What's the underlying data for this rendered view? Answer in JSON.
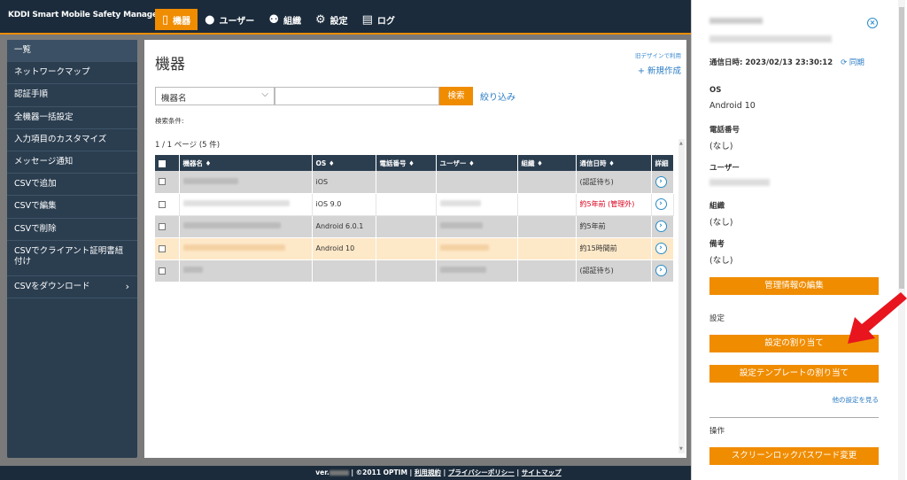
{
  "app": {
    "title": "KDDI Smart Mobile Safety Manager"
  },
  "nav": [
    {
      "label": "機器",
      "icon": "phone-icon",
      "active": true
    },
    {
      "label": "ユーザー",
      "icon": "user-icon",
      "active": false
    },
    {
      "label": "組織",
      "icon": "group-icon",
      "active": false
    },
    {
      "label": "設定",
      "icon": "gear-icon",
      "active": false
    },
    {
      "label": "ログ",
      "icon": "document-icon",
      "active": false
    }
  ],
  "sidebar": {
    "items": [
      {
        "label": "一覧"
      },
      {
        "label": "ネットワークマップ"
      },
      {
        "label": "認証手順"
      },
      {
        "label": "全機器一括設定"
      },
      {
        "label": "入力項目のカスタマイズ"
      },
      {
        "label": "メッセージ通知"
      },
      {
        "label": "CSVで追加"
      },
      {
        "label": "CSVで編集"
      },
      {
        "label": "CSVで削除"
      },
      {
        "label": "CSVでクライアント証明書紐付け"
      },
      {
        "label": "CSVをダウンロード",
        "arrow": "›"
      }
    ]
  },
  "main": {
    "title": "機器",
    "old_design_link": "旧デザインで利用",
    "new_button": "+ 新規作成",
    "search": {
      "select_value": "機器名",
      "chevron": "⌵",
      "button": "検索",
      "filter_link": "絞り込み"
    },
    "conditions_label": "検索条件:",
    "paging": "1 / 1 ページ (5 件)",
    "table": {
      "headers": [
        "機器名 ♦",
        "OS ♦",
        "電話番号 ♦",
        "ユーザー ♦",
        "組織 ♦",
        "通信日時 ♦",
        "詳細"
      ],
      "rows": [
        {
          "os": "iOS",
          "comm": "(認証待ち)",
          "comm_red": false,
          "style": "g"
        },
        {
          "os": "iOS 9.0",
          "comm": "約5年前 (管理外)",
          "comm_red": true,
          "style": "w"
        },
        {
          "os": "Android 6.0.1",
          "comm": "約5年前",
          "comm_red": false,
          "style": "g"
        },
        {
          "os": "Android 10",
          "comm": "約15時間前",
          "comm_red": false,
          "style": "hl"
        },
        {
          "os": "",
          "comm": "(認証待ち)",
          "comm_red": false,
          "style": "g"
        }
      ]
    }
  },
  "footer": {
    "prefix": "ver.",
    "copyright": "| ©2011 OPTIM |",
    "terms": "利用規約",
    "privacy": "プライバシーポリシー",
    "sep": "|",
    "sitemap": "サイトマップ"
  },
  "panel": {
    "comm_time": "通信日時: 2023/02/13 23:30:12",
    "sync": "⟳ 同期",
    "os_label": "OS",
    "os_value": "Android 10",
    "phone_label": "電話番号",
    "phone_value": "(なし)",
    "user_label": "ユーザー",
    "org_label": "組織",
    "org_value": "(なし)",
    "note_label": "備考",
    "note_value": "(なし)",
    "edit_button": "管理情報の編集",
    "settings_label": "設定",
    "assign_settings_button": "設定の割り当て",
    "assign_template_button": "設定テンプレートの割り当て",
    "other_settings_link": "他の設定を見る",
    "operations_label": "操作",
    "screen_lock_button": "スクリーンロックパスワード変更"
  },
  "colors": {
    "accent": "#f08c00",
    "nav_bg": "#1b2b3b",
    "sidebar_bg": "#2b3e50",
    "link": "#2b7cc4",
    "arrow": "#e8141e"
  }
}
